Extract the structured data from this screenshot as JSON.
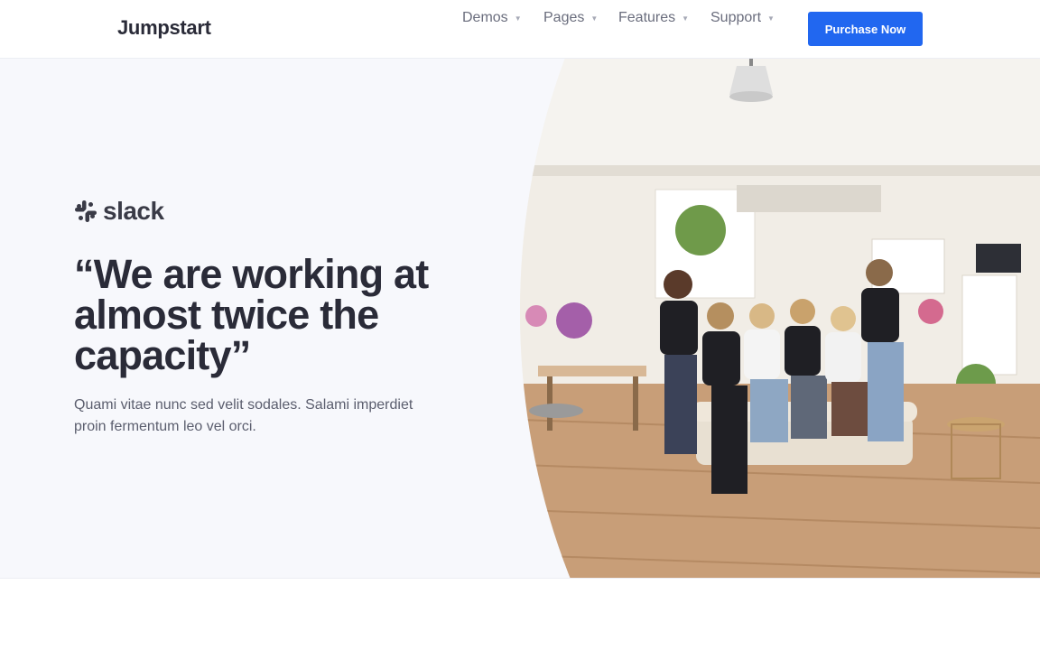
{
  "header": {
    "brand": "Jumpstart",
    "nav": [
      {
        "label": "Demos"
      },
      {
        "label": "Pages"
      },
      {
        "label": "Features"
      },
      {
        "label": "Support"
      }
    ],
    "cta_label": "Purchase Now"
  },
  "hero": {
    "logo_text": "slack",
    "quote": "“We are working at almost twice the capacity”",
    "body": "Quami vitae nunc sed velit sodales. Salami imperdiet proin fermentum leo vel orci."
  },
  "colors": {
    "accent": "#2167f0",
    "hero_bg": "#f7f8fc",
    "heading": "#2a2b38"
  },
  "icons": {
    "nav_caret": "caret-down-icon",
    "logo": "slack-logo-icon"
  }
}
